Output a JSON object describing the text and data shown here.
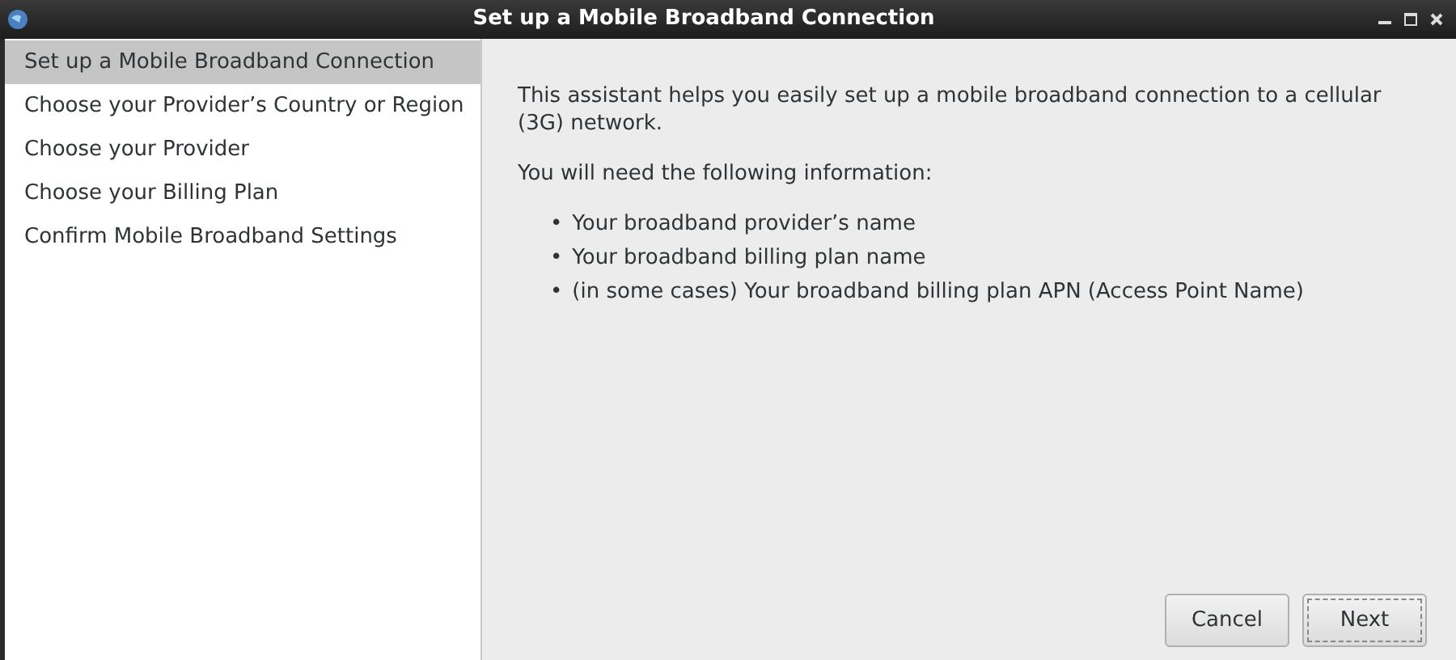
{
  "window": {
    "title": "Set up a Mobile Broadband Connection"
  },
  "steps": [
    {
      "label": "Set up a Mobile Broadband Connection",
      "selected": true
    },
    {
      "label": "Choose your Provider’s Country or Region",
      "selected": false
    },
    {
      "label": "Choose your Provider",
      "selected": false
    },
    {
      "label": "Choose your Billing Plan",
      "selected": false
    },
    {
      "label": "Confirm Mobile Broadband Settings",
      "selected": false
    }
  ],
  "intro": "This assistant helps you easily set up a mobile broadband connection to a cellular (3G) network.",
  "need": "You will need the following information:",
  "bullets": [
    "Your broadband provider’s name",
    "Your broadband billing plan name",
    "(in some cases) Your broadband billing plan APN (Access Point Name)"
  ],
  "bullet_mark": "•",
  "buttons": [
    {
      "label": "Cancel",
      "focused": false
    },
    {
      "label": "Next",
      "focused": true
    }
  ]
}
